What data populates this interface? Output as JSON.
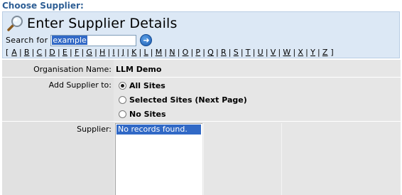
{
  "header": {
    "title": "Choose Supplier:"
  },
  "search_panel": {
    "icon": "magnifier-icon",
    "title": "Enter Supplier Details",
    "search_label": "Search for",
    "search_value": "example",
    "go_icon": "arrow-right-icon",
    "alphabet": [
      "A",
      "B",
      "C",
      "D",
      "E",
      "F",
      "G",
      "H",
      "I",
      "J",
      "K",
      "L",
      "M",
      "N",
      "O",
      "P",
      "Q",
      "R",
      "S",
      "T",
      "U",
      "V",
      "W",
      "X",
      "Y",
      "Z"
    ]
  },
  "form": {
    "org_label": "Organisation Name:",
    "org_value": "LLM Demo",
    "add_label": "Add Supplier to:",
    "options": [
      {
        "label": "All Sites",
        "checked": true
      },
      {
        "label": "Selected Sites (Next Page)",
        "checked": false
      },
      {
        "label": "No Sites",
        "checked": false
      }
    ],
    "supplier_label": "Supplier:",
    "supplier_items": [
      "No records found."
    ]
  },
  "colors": {
    "header": "#2f5f95",
    "panel_bg": "#dce8f5",
    "selection": "#3169c6",
    "form_bg": "#e6e6e6"
  }
}
